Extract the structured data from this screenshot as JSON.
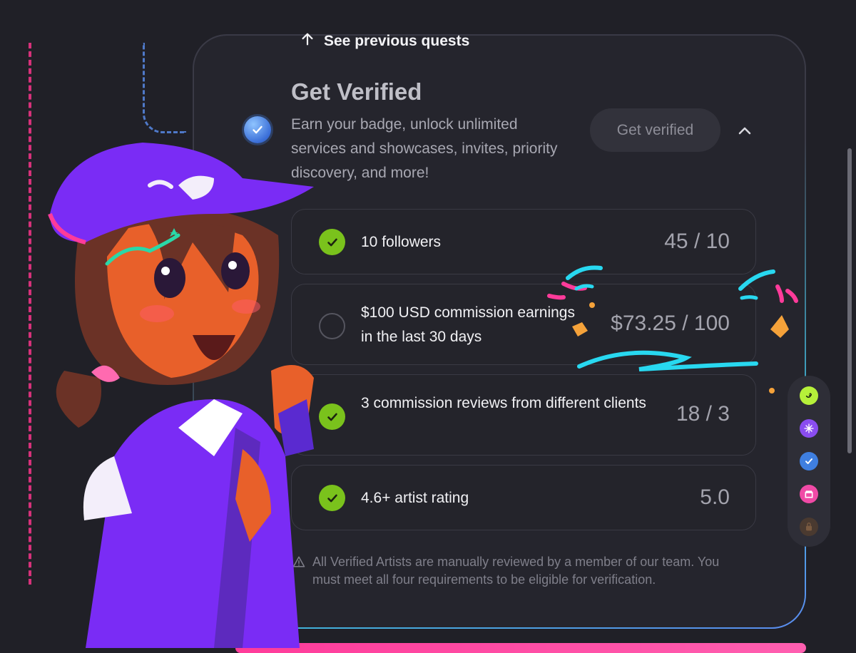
{
  "nav": {
    "previous_quests_label": "See previous quests"
  },
  "quest": {
    "title": "Get Verified",
    "description": "Earn your badge, unlock unlimited services and showcases, invites, priority discovery, and more!",
    "button_label": "Get verified"
  },
  "requirements": [
    {
      "label": "10 followers",
      "progress": "45 / 10",
      "completed": true
    },
    {
      "label": "$100 USD commission earnings in the last 30 days",
      "progress": "$73.25 / 100",
      "completed": false
    },
    {
      "label": "3 commission reviews from different clients",
      "progress": "18 / 3",
      "completed": true
    },
    {
      "label": "4.6+ artist rating",
      "progress": "5.0",
      "completed": true
    }
  ],
  "footnote": "All Verified Artists are manually reviewed by a member of our team. You must meet all four requirements to be eligible for verification.",
  "sidenav_icons": [
    "quest-lime-icon",
    "sparkle-badge-icon",
    "verified-check-icon",
    "shop-icon",
    "locked-bag-icon"
  ],
  "colors": {
    "accent_green": "#7ac21c",
    "card_border_accent": "#3fb6d8",
    "background": "#202027",
    "hat_purple": "#7a2cf5",
    "confetti_cyan": "#28d8f0",
    "confetti_pink": "#ff3b9a"
  }
}
